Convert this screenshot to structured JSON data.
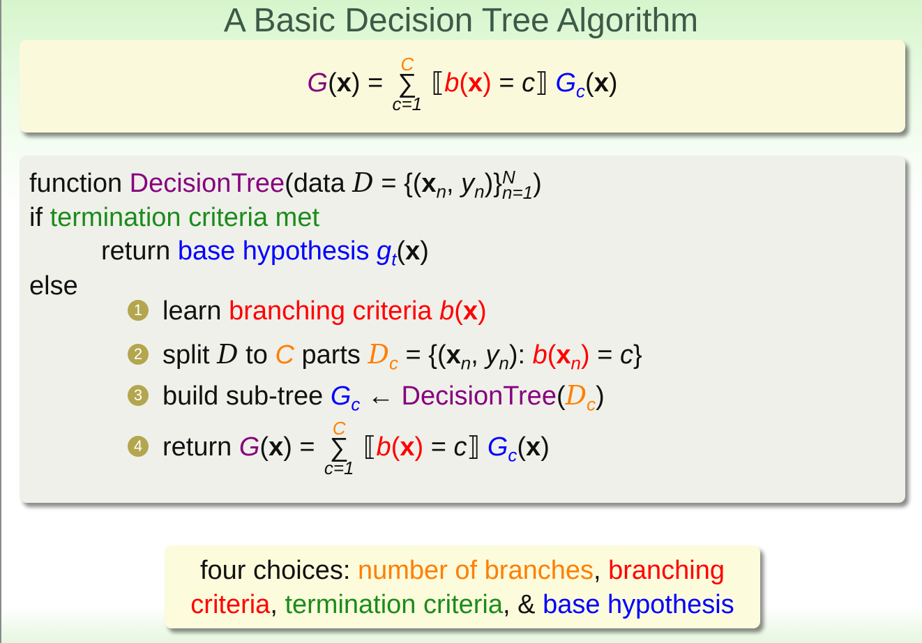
{
  "title": "A Basic Decision Tree Algorithm",
  "formula": {
    "lhs": "G",
    "x": "x",
    "sum_upper": "C",
    "sum_lower": "c=1",
    "b": "b",
    "c": "c",
    "Gc": "G",
    "Gc_sub": "c"
  },
  "algorithm": {
    "kw_function": "function",
    "fn_name": "DecisionTree",
    "kw_data": "data",
    "D": "D",
    "n_sub": "n",
    "N_sup": "N",
    "n_eq_1": "n=1",
    "kw_if": "if",
    "termination": "termination criteria met",
    "kw_return": "return",
    "base_hypothesis": "base hypothesis",
    "g_sym": "g",
    "g_sub": "t",
    "kw_else": "else",
    "steps": [
      {
        "num": "1",
        "learn": "learn",
        "branching": "branching criteria"
      },
      {
        "num": "2",
        "split": "split",
        "to": "to",
        "C": "C",
        "parts": "parts"
      },
      {
        "num": "3",
        "build": "build sub-tree",
        "fn": "DecisionTree"
      },
      {
        "num": "4",
        "ret": "return"
      }
    ]
  },
  "note": {
    "prefix": "four choices:",
    "c1": "number of branches",
    "c2a": "branching",
    "c2b": "criteria",
    "c3": "termination criteria",
    "amp": "&",
    "c4": "base hypothesis"
  },
  "colors": {
    "title": "#3c5a48",
    "purple": "#86007f",
    "red": "#ff0000",
    "blue": "#0000ff",
    "orange": "#ff7f00",
    "green": "#1a8c1a",
    "bullet": "#b3a64e"
  }
}
